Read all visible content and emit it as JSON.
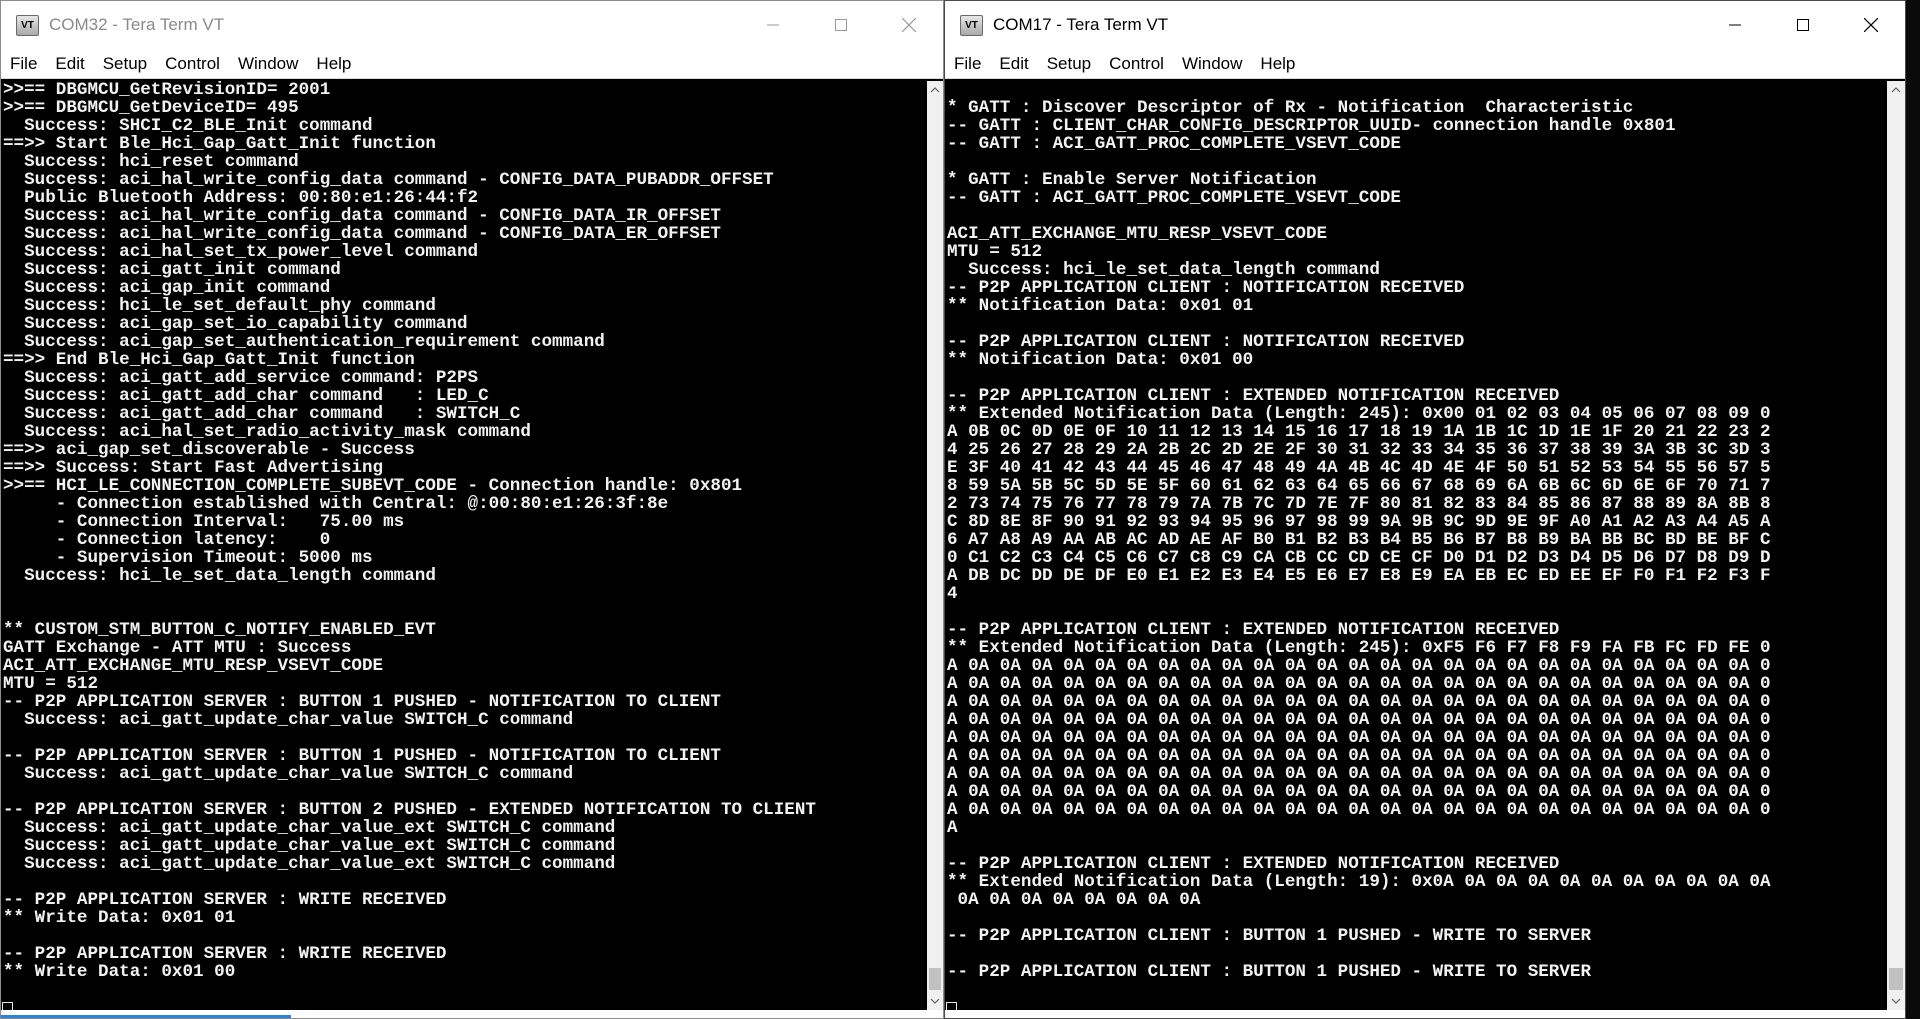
{
  "windows": {
    "left": {
      "title": "COM32 - Tera Term VT",
      "icon_text": "VT",
      "menu": [
        "File",
        "Edit",
        "Setup",
        "Control",
        "Window",
        "Help"
      ],
      "lines": [
        ">>== DBGMCU_GetRevisionID= 2001",
        ">>== DBGMCU_GetDeviceID= 495",
        "  Success: SHCI_C2_BLE_Init command",
        "==>> Start Ble_Hci_Gap_Gatt_Init function",
        "  Success: hci_reset command",
        "  Success: aci_hal_write_config_data command - CONFIG_DATA_PUBADDR_OFFSET",
        "  Public Bluetooth Address: 00:80:e1:26:44:f2",
        "  Success: aci_hal_write_config_data command - CONFIG_DATA_IR_OFFSET",
        "  Success: aci_hal_write_config_data command - CONFIG_DATA_ER_OFFSET",
        "  Success: aci_hal_set_tx_power_level command",
        "  Success: aci_gatt_init command",
        "  Success: aci_gap_init command",
        "  Success: hci_le_set_default_phy command",
        "  Success: aci_gap_set_io_capability command",
        "  Success: aci_gap_set_authentication_requirement command",
        "==>> End Ble_Hci_Gap_Gatt_Init function",
        "  Success: aci_gatt_add_service command: P2PS",
        "  Success: aci_gatt_add_char command   : LED_C",
        "  Success: aci_gatt_add_char command   : SWITCH_C",
        "  Success: aci_hal_set_radio_activity_mask command",
        "==>> aci_gap_set_discoverable - Success",
        "==>> Success: Start Fast Advertising",
        ">>== HCI_LE_CONNECTION_COMPLETE_SUBEVT_CODE - Connection handle: 0x801",
        "     - Connection established with Central: @:00:80:e1:26:3f:8e",
        "     - Connection Interval:   75.00 ms",
        "     - Connection latency:    0",
        "     - Supervision Timeout: 5000 ms",
        "  Success: hci_le_set_data_length command",
        "",
        "",
        "** CUSTOM_STM_BUTTON_C_NOTIFY_ENABLED_EVT",
        "GATT Exchange - ATT MTU : Success",
        "ACI_ATT_EXCHANGE_MTU_RESP_VSEVT_CODE",
        "MTU = 512",
        "-- P2P APPLICATION SERVER : BUTTON 1 PUSHED - NOTIFICATION TO CLIENT",
        "  Success: aci_gatt_update_char_value SWITCH_C command",
        "",
        "-- P2P APPLICATION SERVER : BUTTON 1 PUSHED - NOTIFICATION TO CLIENT",
        "  Success: aci_gatt_update_char_value SWITCH_C command",
        "",
        "-- P2P APPLICATION SERVER : BUTTON 2 PUSHED - EXTENDED NOTIFICATION TO CLIENT",
        "  Success: aci_gatt_update_char_value_ext SWITCH_C command",
        "  Success: aci_gatt_update_char_value_ext SWITCH_C command",
        "  Success: aci_gatt_update_char_value_ext SWITCH_C command",
        "",
        "-- P2P APPLICATION SERVER : WRITE RECEIVED",
        "** Write Data: 0x01 01",
        "",
        "-- P2P APPLICATION SERVER : WRITE RECEIVED",
        "** Write Data: 0x01 00",
        ""
      ]
    },
    "right": {
      "title": "COM17 - Tera Term VT",
      "icon_text": "VT",
      "menu": [
        "File",
        "Edit",
        "Setup",
        "Control",
        "Window",
        "Help"
      ],
      "lines": [
        "",
        "* GATT : Discover Descriptor of Rx - Notification  Characteristic",
        "-- GATT : CLIENT_CHAR_CONFIG_DESCRIPTOR_UUID- connection handle 0x801",
        "-- GATT : ACI_GATT_PROC_COMPLETE_VSEVT_CODE",
        "",
        "* GATT : Enable Server Notification",
        "-- GATT : ACI_GATT_PROC_COMPLETE_VSEVT_CODE",
        "",
        "ACI_ATT_EXCHANGE_MTU_RESP_VSEVT_CODE",
        "MTU = 512",
        "  Success: hci_le_set_data_length command",
        "-- P2P APPLICATION CLIENT : NOTIFICATION RECEIVED",
        "** Notification Data: 0x01 01",
        "",
        "-- P2P APPLICATION CLIENT : NOTIFICATION RECEIVED",
        "** Notification Data: 0x01 00",
        "",
        "-- P2P APPLICATION CLIENT : EXTENDED NOTIFICATION RECEIVED",
        "** Extended Notification Data (Length: 245): 0x00 01 02 03 04 05 06 07 08 09 0",
        "A 0B 0C 0D 0E 0F 10 11 12 13 14 15 16 17 18 19 1A 1B 1C 1D 1E 1F 20 21 22 23 2",
        "4 25 26 27 28 29 2A 2B 2C 2D 2E 2F 30 31 32 33 34 35 36 37 38 39 3A 3B 3C 3D 3",
        "E 3F 40 41 42 43 44 45 46 47 48 49 4A 4B 4C 4D 4E 4F 50 51 52 53 54 55 56 57 5",
        "8 59 5A 5B 5C 5D 5E 5F 60 61 62 63 64 65 66 67 68 69 6A 6B 6C 6D 6E 6F 70 71 7",
        "2 73 74 75 76 77 78 79 7A 7B 7C 7D 7E 7F 80 81 82 83 84 85 86 87 88 89 8A 8B 8",
        "C 8D 8E 8F 90 91 92 93 94 95 96 97 98 99 9A 9B 9C 9D 9E 9F A0 A1 A2 A3 A4 A5 A",
        "6 A7 A8 A9 AA AB AC AD AE AF B0 B1 B2 B3 B4 B5 B6 B7 B8 B9 BA BB BC BD BE BF C",
        "0 C1 C2 C3 C4 C5 C6 C7 C8 C9 CA CB CC CD CE CF D0 D1 D2 D3 D4 D5 D6 D7 D8 D9 D",
        "A DB DC DD DE DF E0 E1 E2 E3 E4 E5 E6 E7 E8 E9 EA EB EC ED EE EF F0 F1 F2 F3 F",
        "4",
        "",
        "-- P2P APPLICATION CLIENT : EXTENDED NOTIFICATION RECEIVED",
        "** Extended Notification Data (Length: 245): 0xF5 F6 F7 F8 F9 FA FB FC FD FE 0",
        "A 0A 0A 0A 0A 0A 0A 0A 0A 0A 0A 0A 0A 0A 0A 0A 0A 0A 0A 0A 0A 0A 0A 0A 0A 0A 0",
        "A 0A 0A 0A 0A 0A 0A 0A 0A 0A 0A 0A 0A 0A 0A 0A 0A 0A 0A 0A 0A 0A 0A 0A 0A 0A 0",
        "A 0A 0A 0A 0A 0A 0A 0A 0A 0A 0A 0A 0A 0A 0A 0A 0A 0A 0A 0A 0A 0A 0A 0A 0A 0A 0",
        "A 0A 0A 0A 0A 0A 0A 0A 0A 0A 0A 0A 0A 0A 0A 0A 0A 0A 0A 0A 0A 0A 0A 0A 0A 0A 0",
        "A 0A 0A 0A 0A 0A 0A 0A 0A 0A 0A 0A 0A 0A 0A 0A 0A 0A 0A 0A 0A 0A 0A 0A 0A 0A 0",
        "A 0A 0A 0A 0A 0A 0A 0A 0A 0A 0A 0A 0A 0A 0A 0A 0A 0A 0A 0A 0A 0A 0A 0A 0A 0A 0",
        "A 0A 0A 0A 0A 0A 0A 0A 0A 0A 0A 0A 0A 0A 0A 0A 0A 0A 0A 0A 0A 0A 0A 0A 0A 0A 0",
        "A 0A 0A 0A 0A 0A 0A 0A 0A 0A 0A 0A 0A 0A 0A 0A 0A 0A 0A 0A 0A 0A 0A 0A 0A 0A 0",
        "A 0A 0A 0A 0A 0A 0A 0A 0A 0A 0A 0A 0A 0A 0A 0A 0A 0A 0A 0A 0A 0A 0A 0A 0A 0A 0",
        "A",
        "",
        "-- P2P APPLICATION CLIENT : EXTENDED NOTIFICATION RECEIVED",
        "** Extended Notification Data (Length: 19): 0x0A 0A 0A 0A 0A 0A 0A 0A 0A 0A 0A",
        " 0A 0A 0A 0A 0A 0A 0A 0A",
        "",
        "-- P2P APPLICATION CLIENT : BUTTON 1 PUSHED - WRITE TO SERVER",
        "",
        "-- P2P APPLICATION CLIENT : BUTTON 1 PUSHED - WRITE TO SERVER",
        ""
      ]
    }
  }
}
